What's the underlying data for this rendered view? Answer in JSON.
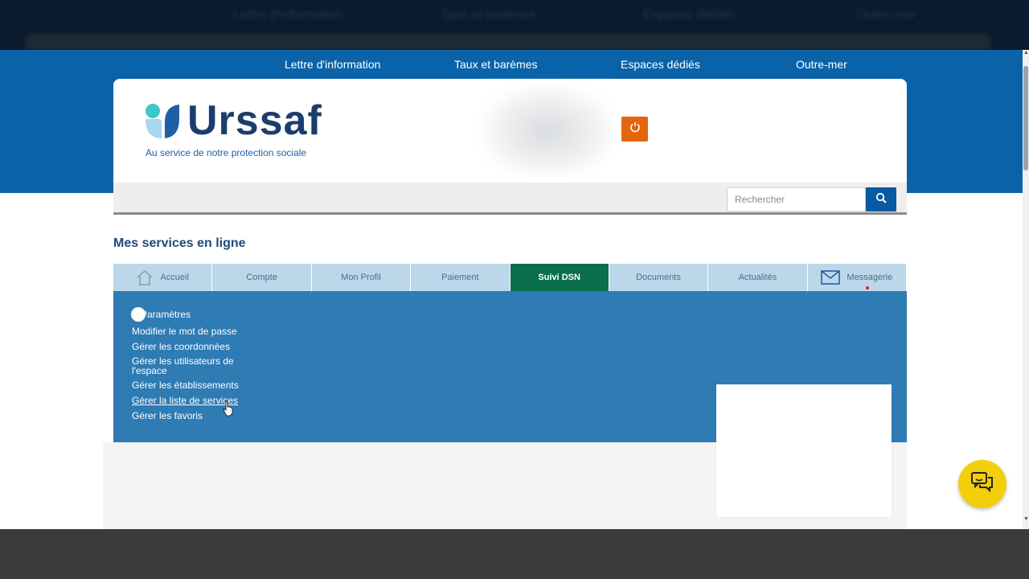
{
  "top_nav": [
    "Lettre d'information",
    "Taux et barèmes",
    "Espaces dédiés",
    "Outre-mer"
  ],
  "brand": {
    "name": "Urssaf",
    "tagline": "Au service de notre protection sociale"
  },
  "search": {
    "placeholder": "Rechercher"
  },
  "section_title": "Mes services en ligne",
  "tabs": [
    {
      "label": "Accueil",
      "active": false
    },
    {
      "label": "Compte",
      "active": false
    },
    {
      "label": "Mon Profil",
      "active": false
    },
    {
      "label": "Paiement",
      "active": false
    },
    {
      "label": "Suivi DSN",
      "active": true
    },
    {
      "label": "Documents",
      "active": false
    },
    {
      "label": "Actualités",
      "active": false
    },
    {
      "label": "Messagerie",
      "active": false
    }
  ],
  "dropdown": {
    "heading": "Paramètres",
    "items": [
      "Modifier le mot de passe",
      "Gérer les coordonnées",
      "Gérer les utilisateurs de l'espace",
      "Gérer les établissements",
      "Gérer la liste de services",
      "Gérer les favoris"
    ],
    "hovered_index": 4
  },
  "colors": {
    "header_blue": "#0a63a8",
    "tab_bg": "#bdd7ea",
    "tab_active": "#0b6f4f",
    "dropdown_bg": "#2f7bb4",
    "power_orange": "#e5650d",
    "chat_yellow": "#f2cf0a"
  },
  "icons": [
    "home-icon",
    "envelope-icon",
    "power-icon",
    "search-icon",
    "chat-icon"
  ]
}
